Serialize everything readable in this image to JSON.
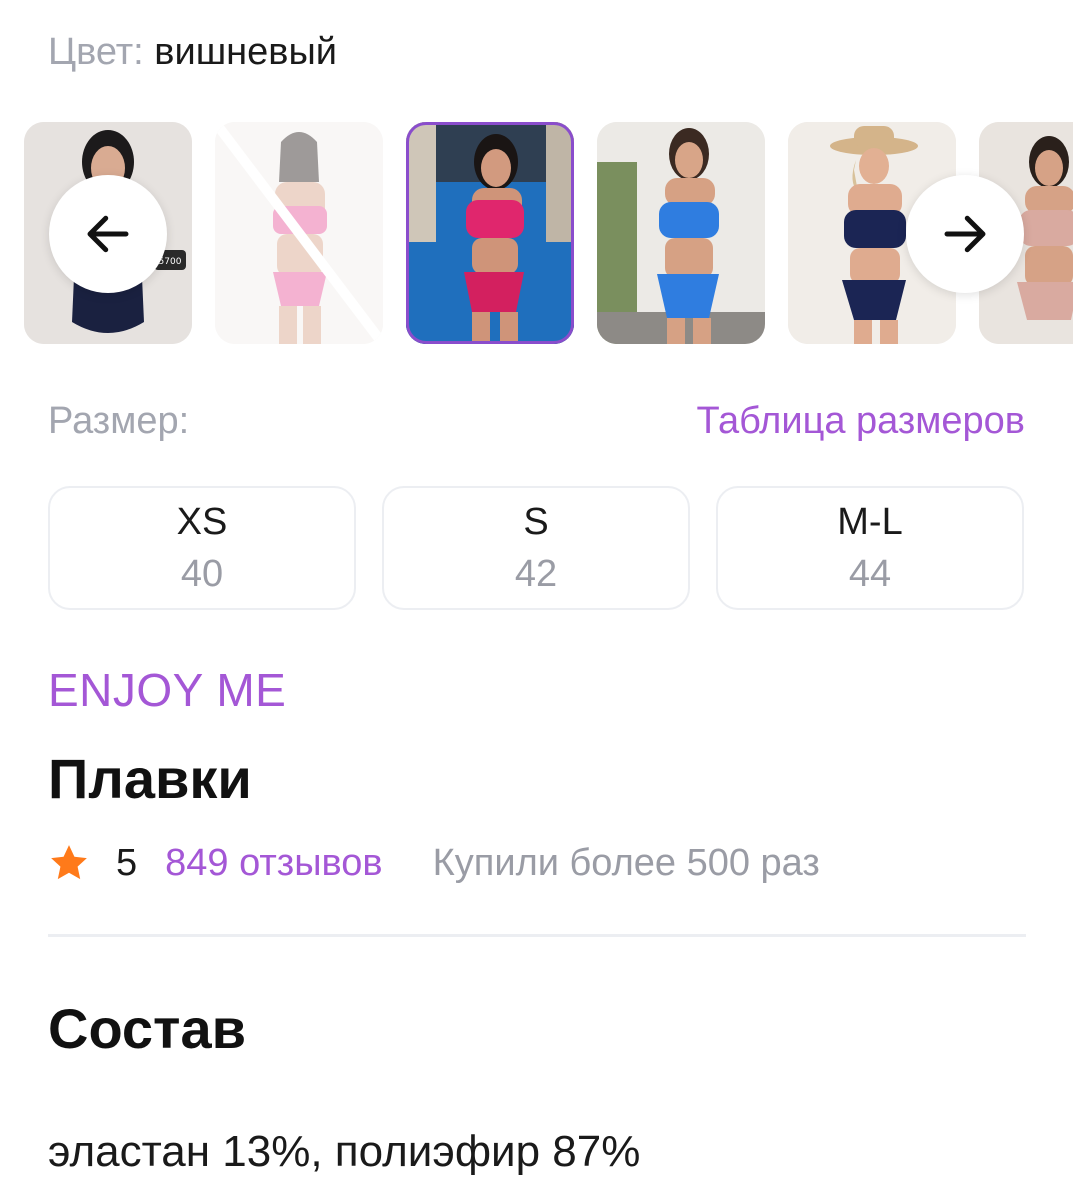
{
  "color": {
    "label": "Цвет:",
    "value": "вишневый"
  },
  "thumbnails": [
    {
      "name": "navy-bodysuit",
      "state": "available",
      "price_sticker": "5700"
    },
    {
      "name": "pink-bikini",
      "state": "unavailable"
    },
    {
      "name": "cherry-bikini",
      "state": "selected"
    },
    {
      "name": "blue-bikini",
      "state": "available"
    },
    {
      "name": "navy-bikini-hat",
      "state": "available"
    },
    {
      "name": "beige-bikini",
      "state": "available"
    }
  ],
  "nav": {
    "prev_icon": "arrow-left-icon",
    "next_icon": "arrow-right-icon"
  },
  "size": {
    "label": "Размер:",
    "chart_link": "Таблица размеров",
    "options": [
      {
        "size": "XS",
        "ru": "40"
      },
      {
        "size": "S",
        "ru": "42"
      },
      {
        "size": "M-L",
        "ru": "44"
      }
    ]
  },
  "product": {
    "brand": "ENJOY ME",
    "title": "Плавки",
    "rating": "5",
    "reviews": "849 отзывов",
    "purchases": "Купили более 500 раз"
  },
  "composition": {
    "title": "Состав",
    "text": "эластан 13%, полиэфир 87%"
  },
  "colors": {
    "accent": "#a457d6",
    "selected_border": "#8a4dcc",
    "star": "#ff7a1a",
    "muted": "#a3a6b0"
  }
}
